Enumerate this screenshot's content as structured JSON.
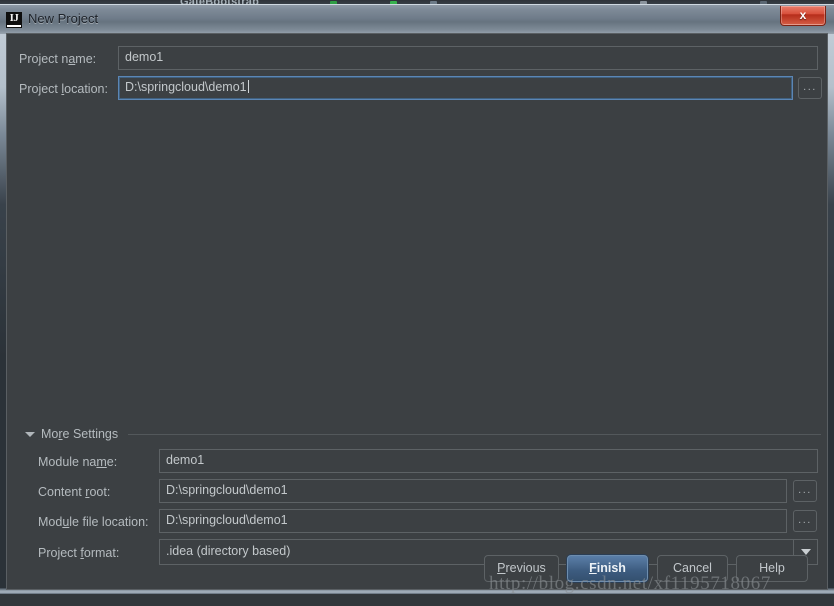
{
  "background": {
    "app_label": "GateBootstrap"
  },
  "window": {
    "title": "New Project",
    "icon": "intellij-idea-icon",
    "close_label": "x",
    "close_color": "#c23c23",
    "bg_color": "#3c4043",
    "accent_color": "#4a6b91"
  },
  "form": {
    "project_name": {
      "label_pre": "Project n",
      "label_mnemonic": "a",
      "label_post": "me:",
      "value": "demo1"
    },
    "project_location": {
      "label_pre": "Project ",
      "label_mnemonic": "l",
      "label_post": "ocation:",
      "value": "D:\\springcloud\\demo1",
      "browse_label": "..."
    }
  },
  "more_settings": {
    "label_pre": "Mo",
    "label_mnemonic": "r",
    "label_post": "e Settings",
    "expanded": true,
    "module_name": {
      "label_pre": "Module na",
      "label_mnemonic": "m",
      "label_post": "e:",
      "value": "demo1"
    },
    "content_root": {
      "label_pre": "Content ",
      "label_mnemonic": "r",
      "label_post": "oot:",
      "value": "D:\\springcloud\\demo1",
      "browse_label": "..."
    },
    "module_file_location": {
      "label_pre": "Mod",
      "label_mnemonic": "u",
      "label_post": "le file location:",
      "value": "D:\\springcloud\\demo1",
      "browse_label": "..."
    },
    "project_format": {
      "label_pre": "Project ",
      "label_mnemonic": "f",
      "label_post": "ormat:",
      "value": ".idea (directory based)",
      "options": [
        ".idea (directory based)"
      ]
    }
  },
  "buttons": {
    "previous": {
      "pre": "",
      "mnemonic": "P",
      "post": "revious"
    },
    "finish": {
      "pre": "",
      "mnemonic": "F",
      "post": "inish"
    },
    "cancel": {
      "pre": "",
      "mnemonic": "",
      "post": "Cancel"
    },
    "help": {
      "pre": "",
      "mnemonic": "",
      "post": "Help"
    }
  },
  "watermark": {
    "text": "http://blog.csdn.net/xf1195718067"
  }
}
